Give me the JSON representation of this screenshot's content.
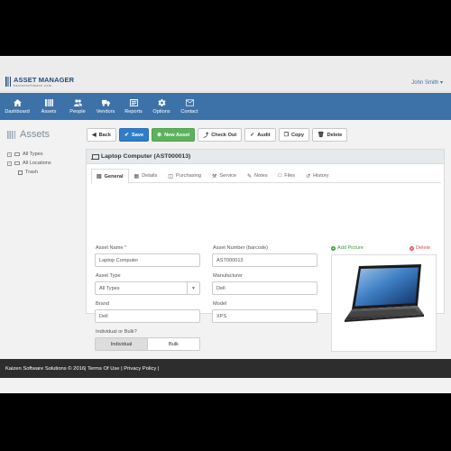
{
  "app": {
    "logo_name": "ASSET MANAGER",
    "logo_sub": "kaizensoftware.com",
    "user": "John Smith ▾"
  },
  "nav": [
    {
      "label": "Dashboard",
      "icon": "home-icon"
    },
    {
      "label": "Assets",
      "icon": "assets-icon"
    },
    {
      "label": "People",
      "icon": "people-icon"
    },
    {
      "label": "Vendors",
      "icon": "truck-icon"
    },
    {
      "label": "Reports",
      "icon": "reports-icon"
    },
    {
      "label": "Options",
      "icon": "gear-icon"
    },
    {
      "label": "Contact",
      "icon": "envelope-icon"
    }
  ],
  "sidebar": {
    "title": "Assets",
    "tree": [
      {
        "label": "All Types",
        "icon": "folder-icon"
      },
      {
        "label": "All Locations",
        "icon": "folder-icon"
      },
      {
        "label": "Trash",
        "icon": "trash-icon"
      }
    ]
  },
  "toolbar": {
    "back": "Back",
    "save": "Save",
    "new_asset": "New Asset",
    "check_out": "Check Out",
    "audit": "Audit",
    "copy": "Copy",
    "delete": "Delete"
  },
  "panel": {
    "title": "Laptop Computer (AST000013)",
    "tabs": [
      {
        "label": "General",
        "icon": "general-icon",
        "active": true
      },
      {
        "label": "Details",
        "icon": "details-icon"
      },
      {
        "label": "Purchasing",
        "icon": "purchasing-icon"
      },
      {
        "label": "Service",
        "icon": "wrench-icon"
      },
      {
        "label": "Notes",
        "icon": "pencil-icon"
      },
      {
        "label": "Files",
        "icon": "file-icon"
      },
      {
        "label": "History",
        "icon": "history-icon"
      }
    ],
    "fields": {
      "asset_name_label": "Asset Name",
      "asset_name_req": "*",
      "asset_name_value": "Laptop Computer",
      "asset_number_label": "Asset Number (barcode)",
      "asset_number_value": "AST000013",
      "asset_type_label": "Asset Type",
      "asset_type_value": "All Types",
      "manufacturer_label": "Manufacturer",
      "manufacturer_value": "Dell",
      "brand_label": "Brand",
      "brand_value": "Dell",
      "model_label": "Model",
      "model_value": "XPS",
      "individual_bulk_label": "Individual or Bulk?",
      "individual": "Individual",
      "bulk": "Bulk"
    },
    "picture": {
      "add": "Add Picture",
      "delete": "Delete"
    }
  },
  "footer": {
    "text": "Kaizen Software Solutions © 2016|  Terms Of Use  |  Privacy Policy  |"
  },
  "colors": {
    "navbar": "#3d72a8",
    "save_button": "#2f7dc8",
    "new_asset_button": "#5cb25c",
    "footer": "#2d2d2d"
  }
}
